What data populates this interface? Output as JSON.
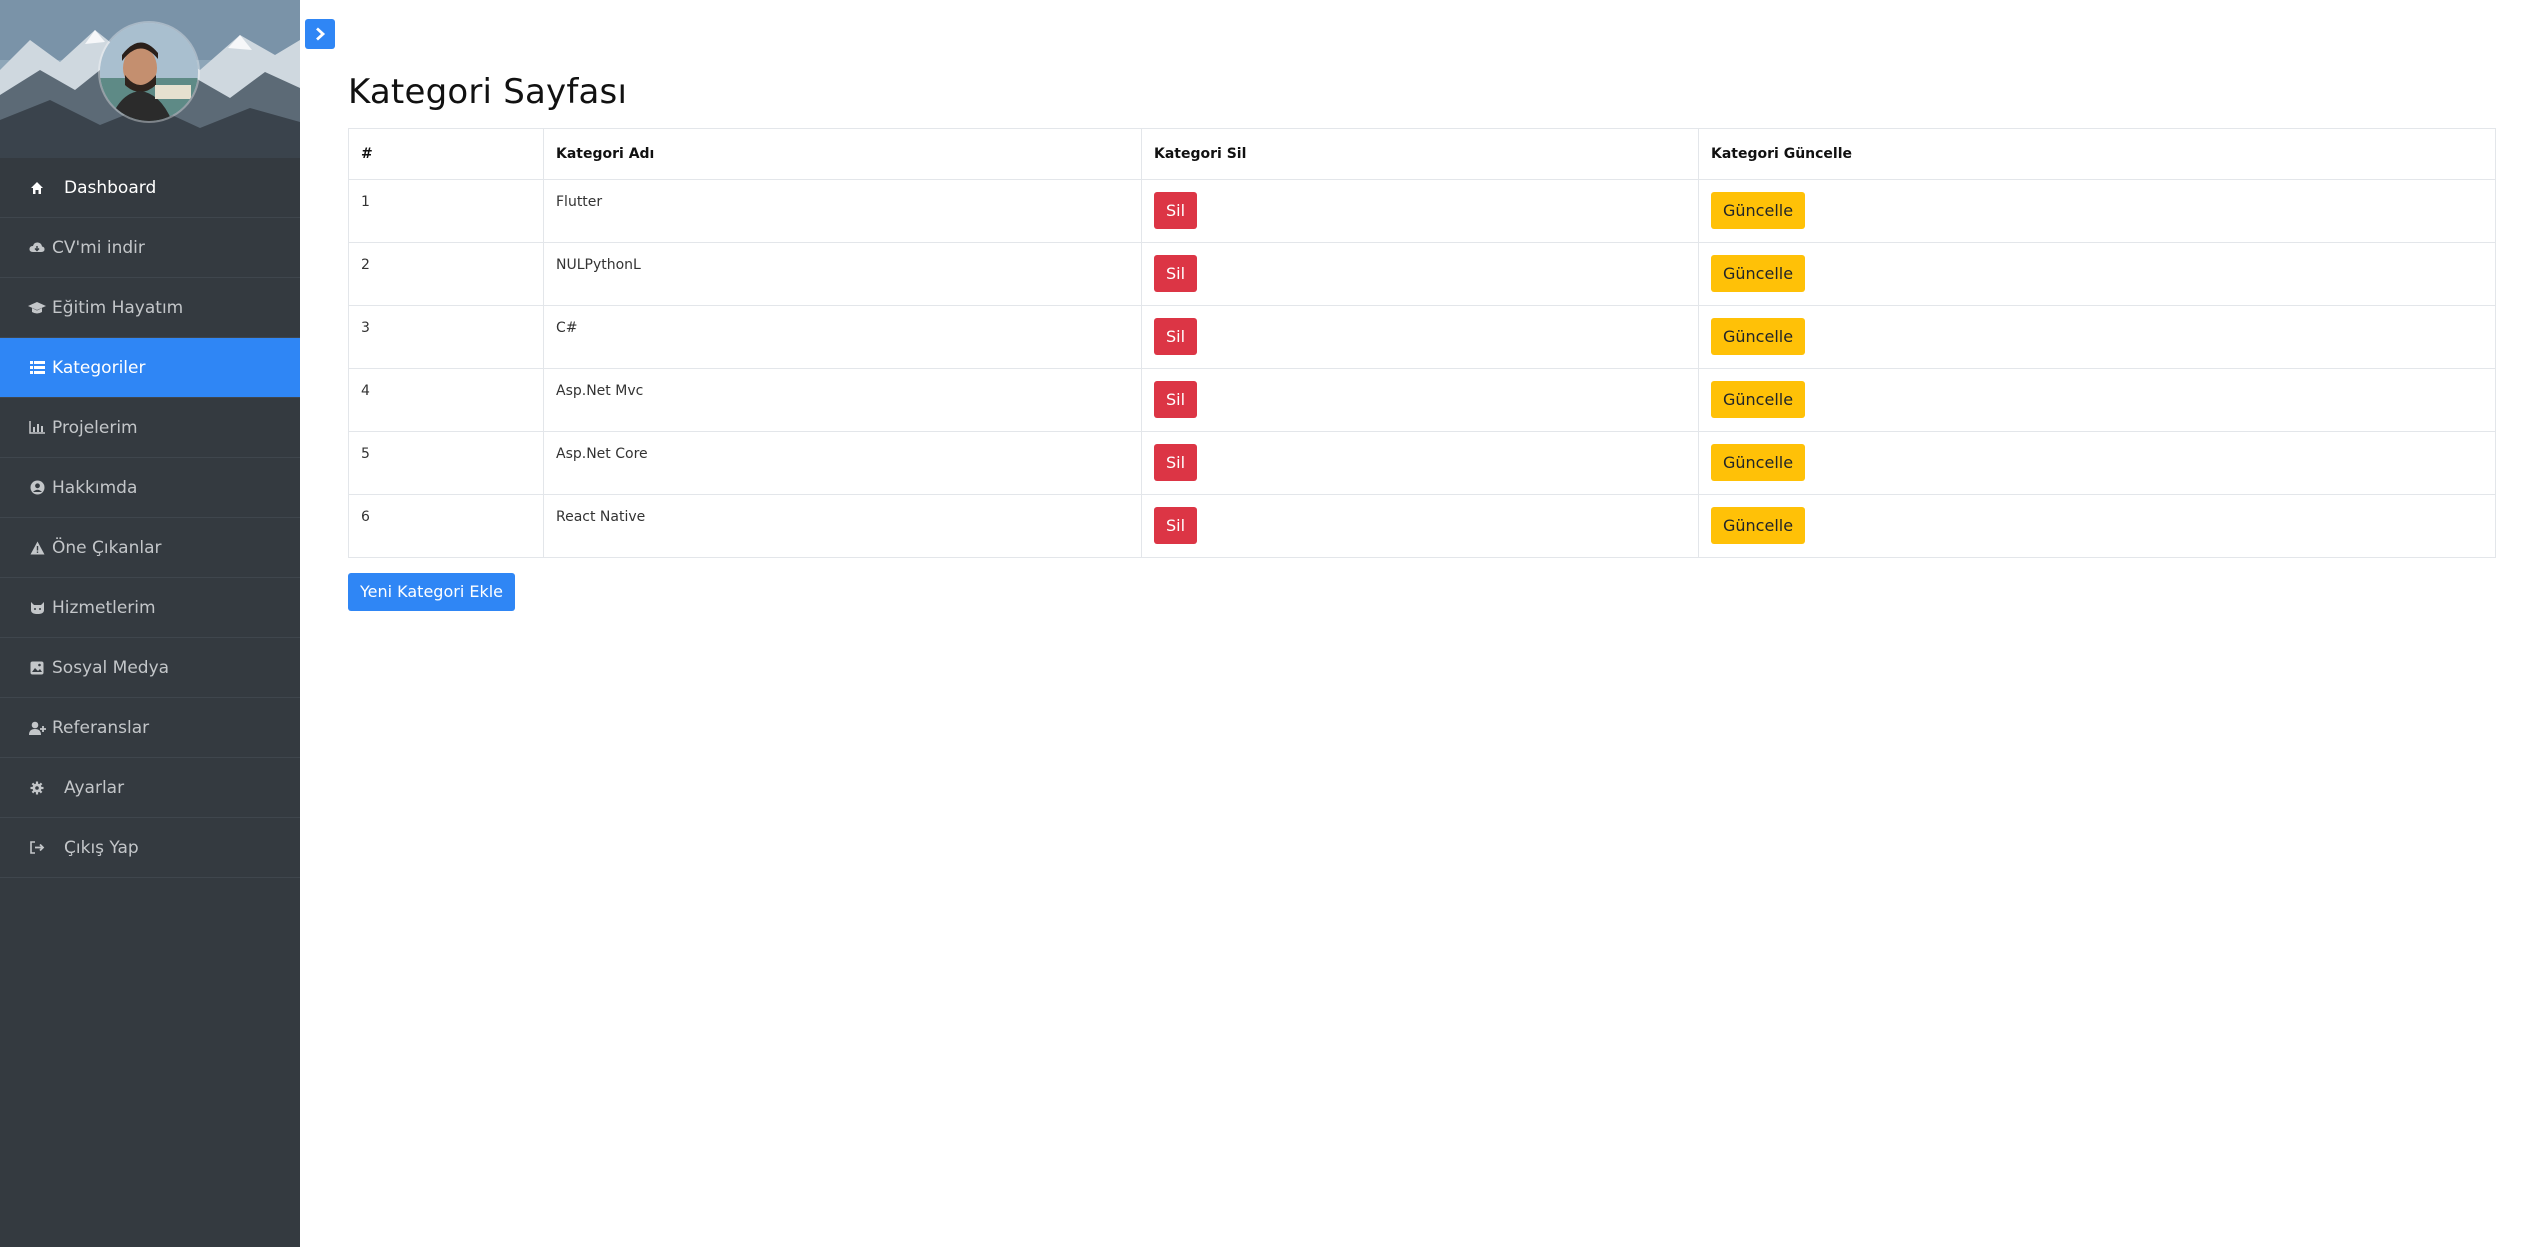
{
  "sidebar": {
    "items": [
      {
        "label": "Dashboard",
        "icon": "home-icon",
        "active": false
      },
      {
        "label": "CV'mi indir",
        "icon": "cloud-download-icon",
        "active": false
      },
      {
        "label": "Eğitim Hayatım",
        "icon": "graduation-cap-icon",
        "active": false
      },
      {
        "label": "Kategoriler",
        "icon": "list-icon",
        "active": true
      },
      {
        "label": "Projelerim",
        "icon": "bar-chart-icon",
        "active": false
      },
      {
        "label": "Hakkımda",
        "icon": "user-circle-icon",
        "active": false
      },
      {
        "label": "Öne Çıkanlar",
        "icon": "warning-icon",
        "active": false
      },
      {
        "label": "Hizmetlerim",
        "icon": "cat-icon",
        "active": false
      },
      {
        "label": "Sosyal Medya",
        "icon": "image-icon",
        "active": false
      },
      {
        "label": "Referanslar",
        "icon": "user-plus-icon",
        "active": false
      },
      {
        "label": "Ayarlar",
        "icon": "gear-icon",
        "active": false
      },
      {
        "label": "Çıkış Yap",
        "icon": "sign-out-icon",
        "active": false
      }
    ]
  },
  "main": {
    "title": "Kategori Sayfası",
    "table": {
      "headers": [
        "#",
        "Kategori Adı",
        "Kategori Sil",
        "Kategori Güncelle"
      ],
      "rows": [
        {
          "id": "1",
          "name": "Flutter"
        },
        {
          "id": "2",
          "name": "NULPythonL"
        },
        {
          "id": "3",
          "name": "C#"
        },
        {
          "id": "4",
          "name": "Asp.Net Mvc"
        },
        {
          "id": "5",
          "name": "Asp.Net Core"
        },
        {
          "id": "6",
          "name": "React Native"
        }
      ],
      "delete_label": "Sil",
      "update_label": "Güncelle"
    },
    "add_button_label": "Yeni Kategori Ekle"
  },
  "colors": {
    "primary": "#2f86f5",
    "danger": "#dc3545",
    "warning": "#ffc107",
    "sidebar": "#343a40"
  }
}
